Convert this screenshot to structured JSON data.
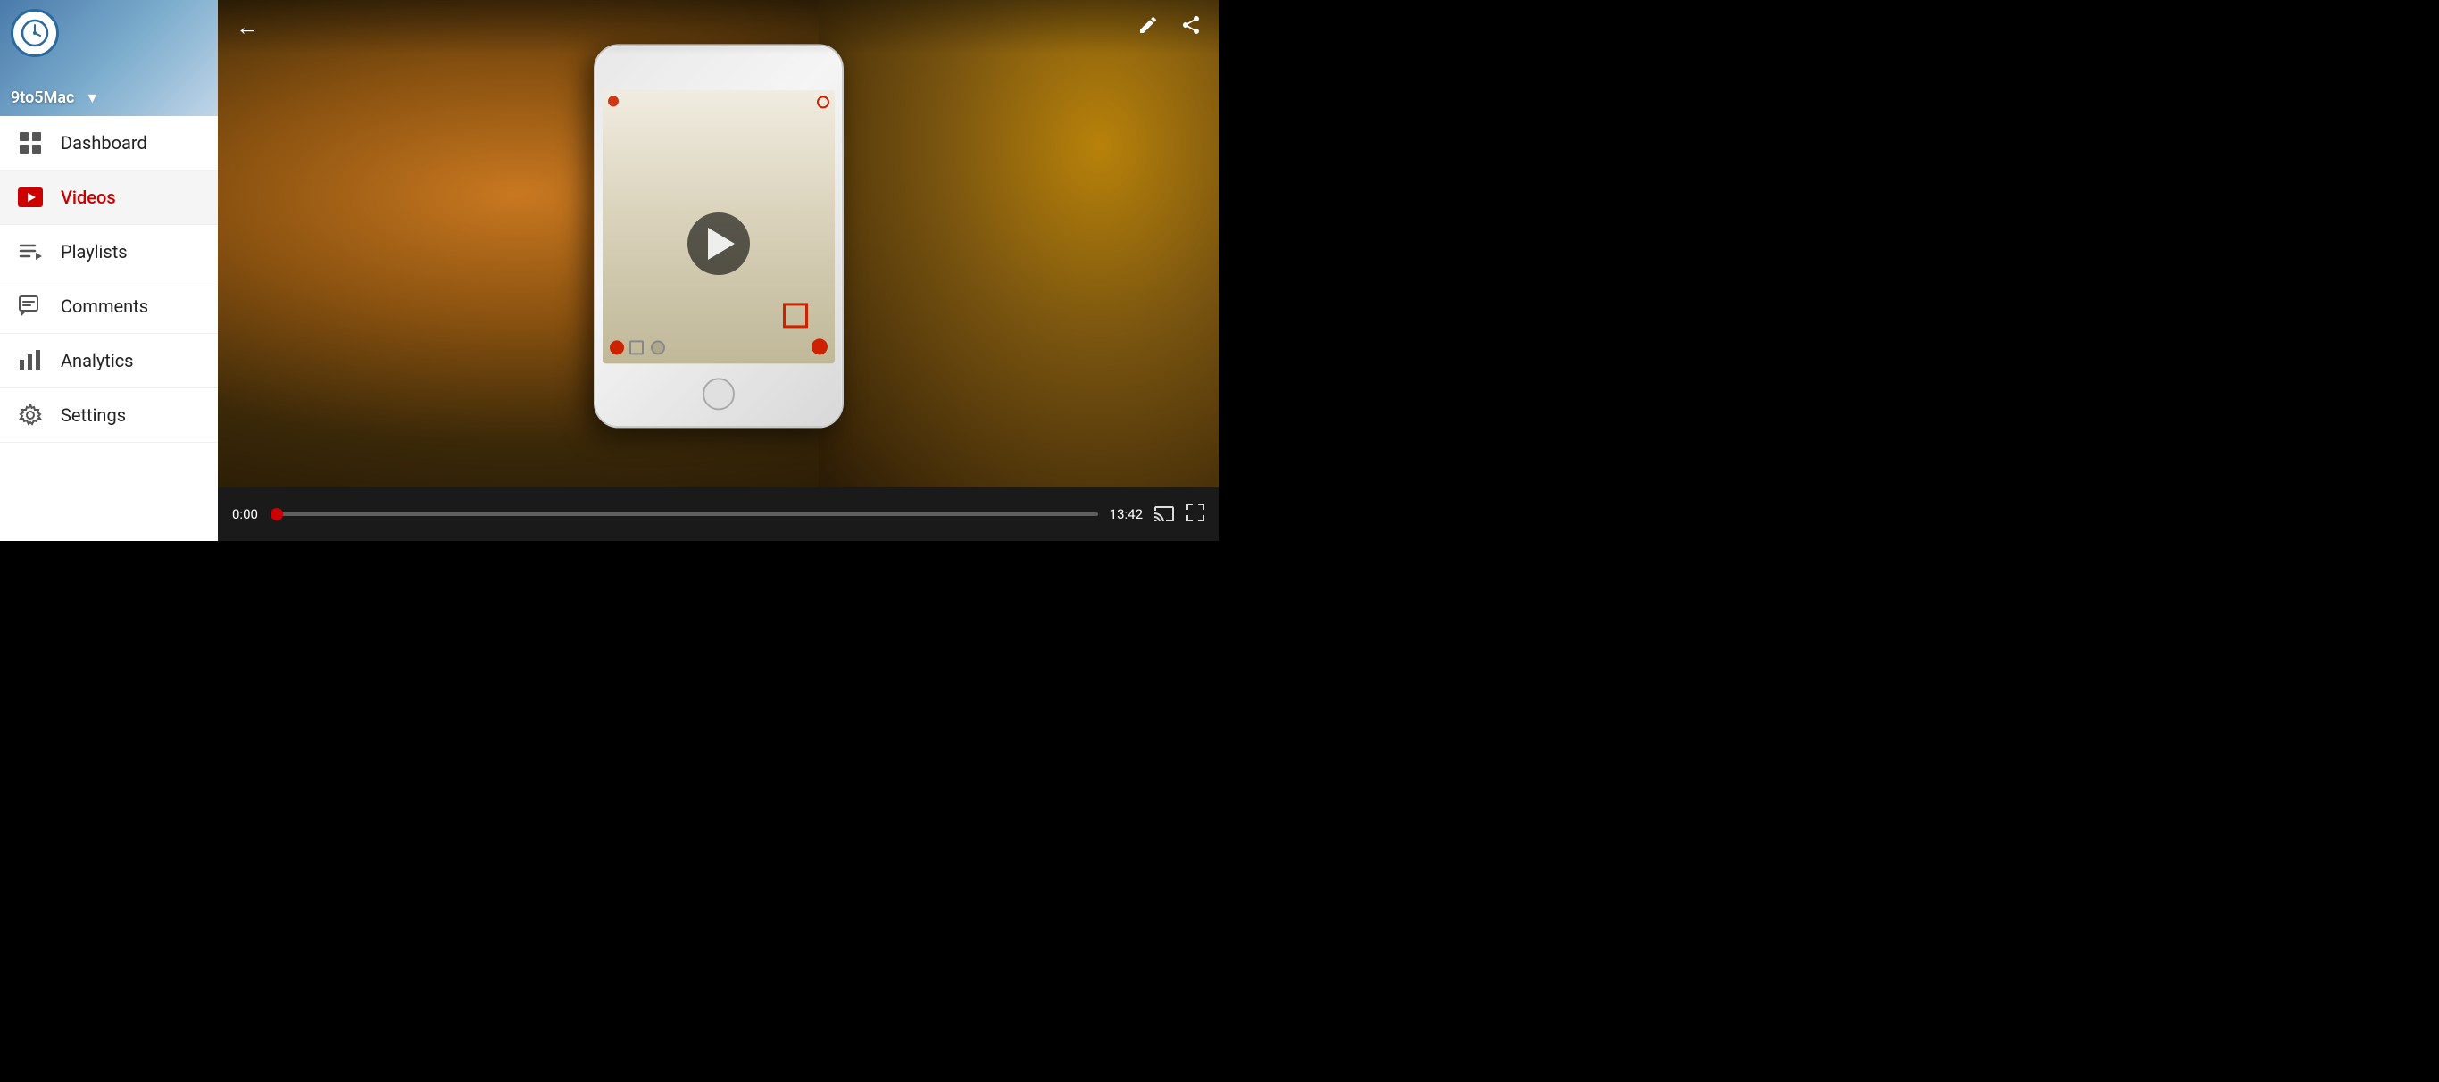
{
  "sidebar": {
    "channel_name": "9to5Mac",
    "channel_brand": "9TO5Mac",
    "dropdown_arrow": "▼",
    "nav_items": [
      {
        "id": "dashboard",
        "label": "Dashboard",
        "icon": "dashboard-icon",
        "active": false
      },
      {
        "id": "videos",
        "label": "Videos",
        "icon": "videos-icon",
        "active": true
      },
      {
        "id": "playlists",
        "label": "Playlists",
        "icon": "playlists-icon",
        "active": false
      },
      {
        "id": "comments",
        "label": "Comments",
        "icon": "comments-icon",
        "active": false
      },
      {
        "id": "analytics",
        "label": "Analytics",
        "icon": "analytics-icon",
        "active": false
      },
      {
        "id": "settings",
        "label": "Settings",
        "icon": "settings-icon",
        "active": false
      }
    ]
  },
  "video_player": {
    "back_icon": "←",
    "edit_icon": "✎",
    "share_icon": "⎙",
    "time_current": "0:00",
    "time_total": "13:42",
    "progress_percent": 0,
    "cast_icon": "⬛",
    "fullscreen_icon": "⛶",
    "play_icon": "▶"
  }
}
